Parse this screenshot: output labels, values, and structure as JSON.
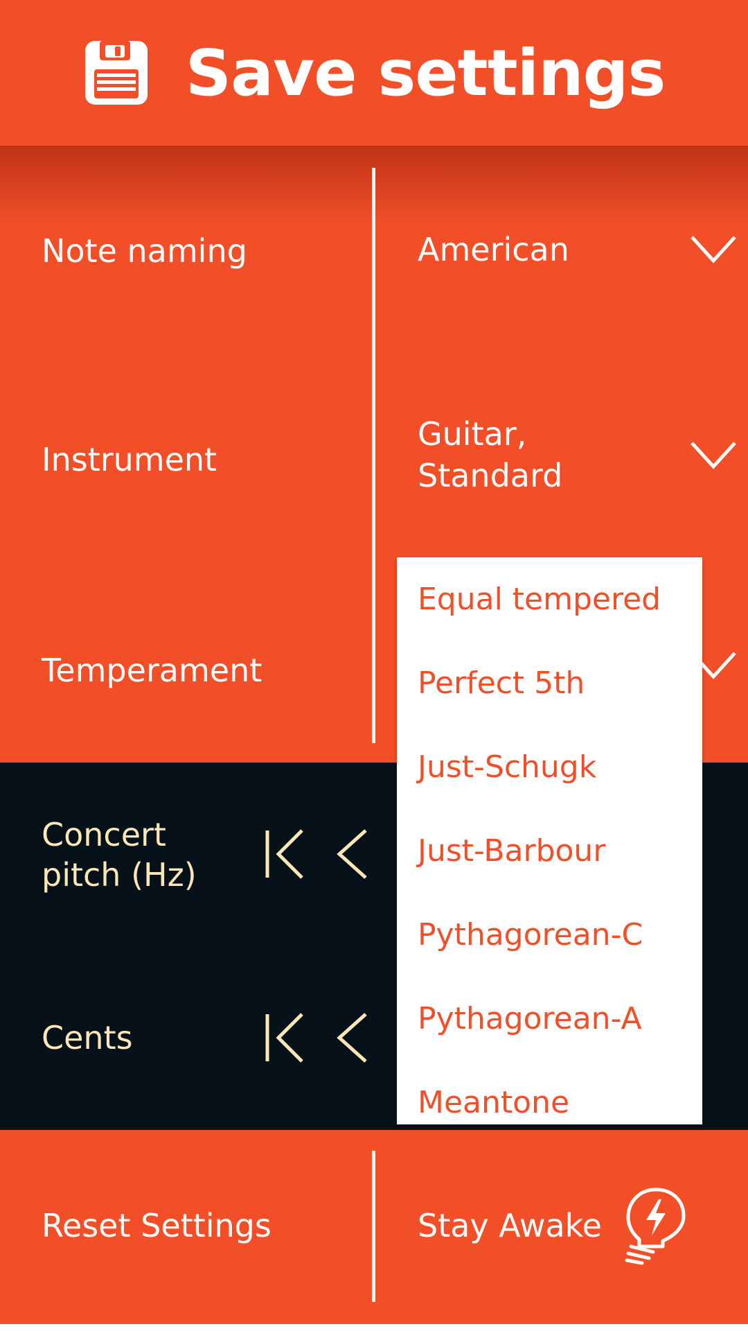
{
  "header": {
    "title": "Save settings",
    "icon": "floppy-disk-icon"
  },
  "settings": {
    "note_naming": {
      "label": "Note naming",
      "value": "American"
    },
    "instrument": {
      "label": "Instrument",
      "value_line1": "Guitar,",
      "value_line2": "Standard"
    },
    "temperament": {
      "label": "Temperament"
    }
  },
  "tuning": {
    "concert_pitch": {
      "label_line1": "Concert",
      "label_line2": "pitch (Hz)"
    },
    "cents": {
      "label": "Cents"
    }
  },
  "temperament_options": [
    "Equal tempered",
    "Perfect 5th",
    "Just-Schugk",
    "Just-Barbour",
    "Pythagorean-C",
    "Pythagorean-A",
    "Meantone"
  ],
  "footer": {
    "reset_label": "Reset Settings",
    "stay_awake_label": "Stay Awake"
  },
  "colors": {
    "accent": "#f24f28",
    "dark": "#06111a",
    "cream": "#fbe7b6",
    "white": "#ffffff"
  }
}
